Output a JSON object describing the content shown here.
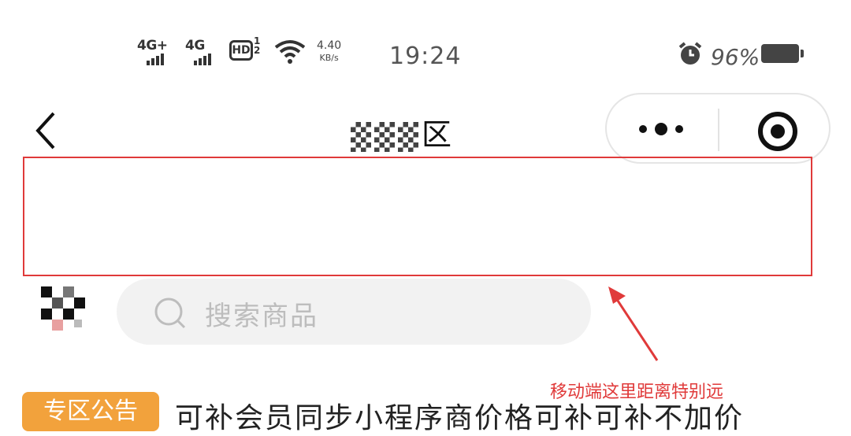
{
  "status_bar": {
    "network1": "4G+",
    "network2": "4G",
    "hd_label": "HD",
    "hd_sub_top": "1",
    "hd_sub_bottom": "2",
    "speed_value": "4.40",
    "speed_unit": "KB/s",
    "time": "19:24",
    "battery_percent": "96%"
  },
  "nav": {
    "title_visible": "区"
  },
  "search": {
    "placeholder": "搜索商品"
  },
  "annotation": {
    "text": "移动端这里距离特别远",
    "color": "#e03a3a"
  },
  "notice": {
    "badge": "专区公告",
    "text": "可补会员同步小程序商价格可补可补不加价"
  },
  "colors": {
    "accent": "#f2a23c",
    "annotation": "#e03a3a"
  }
}
